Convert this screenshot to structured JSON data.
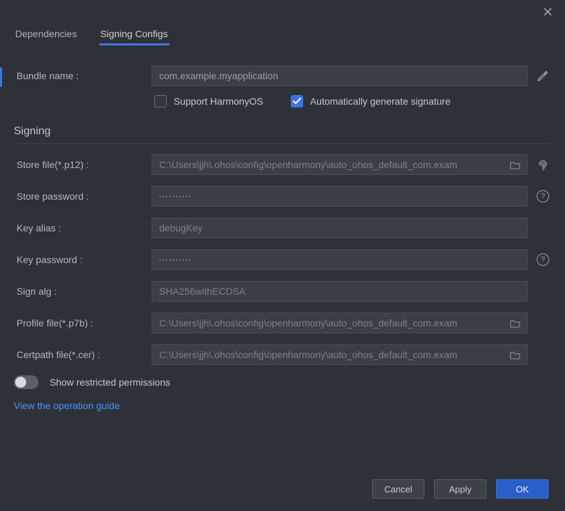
{
  "tabs": {
    "dependencies": "Dependencies",
    "signingConfigs": "Signing Configs"
  },
  "bundle": {
    "label": "Bundle name :",
    "value": "com.example.myapplication"
  },
  "checkboxes": {
    "supportHarmony": "Support HarmonyOS",
    "autoGenerate": "Automatically generate signature"
  },
  "signing": {
    "title": "Signing",
    "storeFile": {
      "label": "Store file(*.p12) :",
      "value": "C:\\Users\\jjh\\.ohos\\config\\openharmony\\auto_ohos_default_com.exam"
    },
    "storePassword": {
      "label": "Store password :",
      "value": "••••••••••"
    },
    "keyAlias": {
      "label": "Key alias :",
      "value": "debugKey"
    },
    "keyPassword": {
      "label": "Key password :",
      "value": "••••••••••"
    },
    "signAlg": {
      "label": "Sign alg :",
      "value": "SHA256withECDSA"
    },
    "profileFile": {
      "label": "Profile file(*.p7b) :",
      "value": "C:\\Users\\jjh\\.ohos\\config\\openharmony\\auto_ohos_default_com.exam"
    },
    "certpathFile": {
      "label": "Certpath file(*.cer) :",
      "value": "C:\\Users\\jjh\\.ohos\\config\\openharmony\\auto_ohos_default_com.exam"
    }
  },
  "toggle": {
    "label": "Show restricted permissions"
  },
  "link": "View the operation guide",
  "buttons": {
    "cancel": "Cancel",
    "apply": "Apply",
    "ok": "OK"
  }
}
